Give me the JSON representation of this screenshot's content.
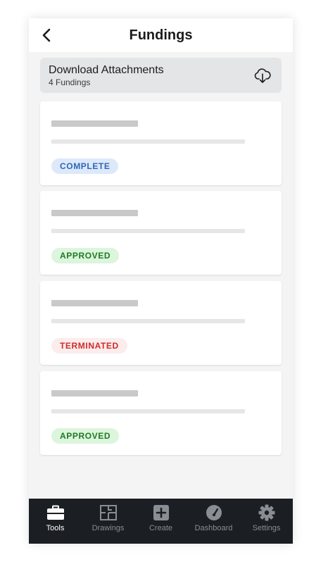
{
  "header": {
    "title": "Fundings"
  },
  "download": {
    "title": "Download Attachments",
    "subtitle": "4 Fundings"
  },
  "fundings": [
    {
      "status": "COMPLETE"
    },
    {
      "status": "APPROVED"
    },
    {
      "status": "TERMINATED"
    },
    {
      "status": "APPROVED"
    }
  ],
  "tabs": [
    {
      "label": "Tools",
      "icon": "toolbox-icon",
      "active": true
    },
    {
      "label": "Drawings",
      "icon": "floorplan-icon",
      "active": false
    },
    {
      "label": "Create",
      "icon": "plus-square-icon",
      "active": false
    },
    {
      "label": "Dashboard",
      "icon": "gauge-icon",
      "active": false
    },
    {
      "label": "Settings",
      "icon": "gear-icon",
      "active": false
    }
  ],
  "colors": {
    "complete": "#2f66b8",
    "approved": "#1e7a22",
    "terminated": "#d02a2a",
    "tabbar": "#1b1e22"
  }
}
